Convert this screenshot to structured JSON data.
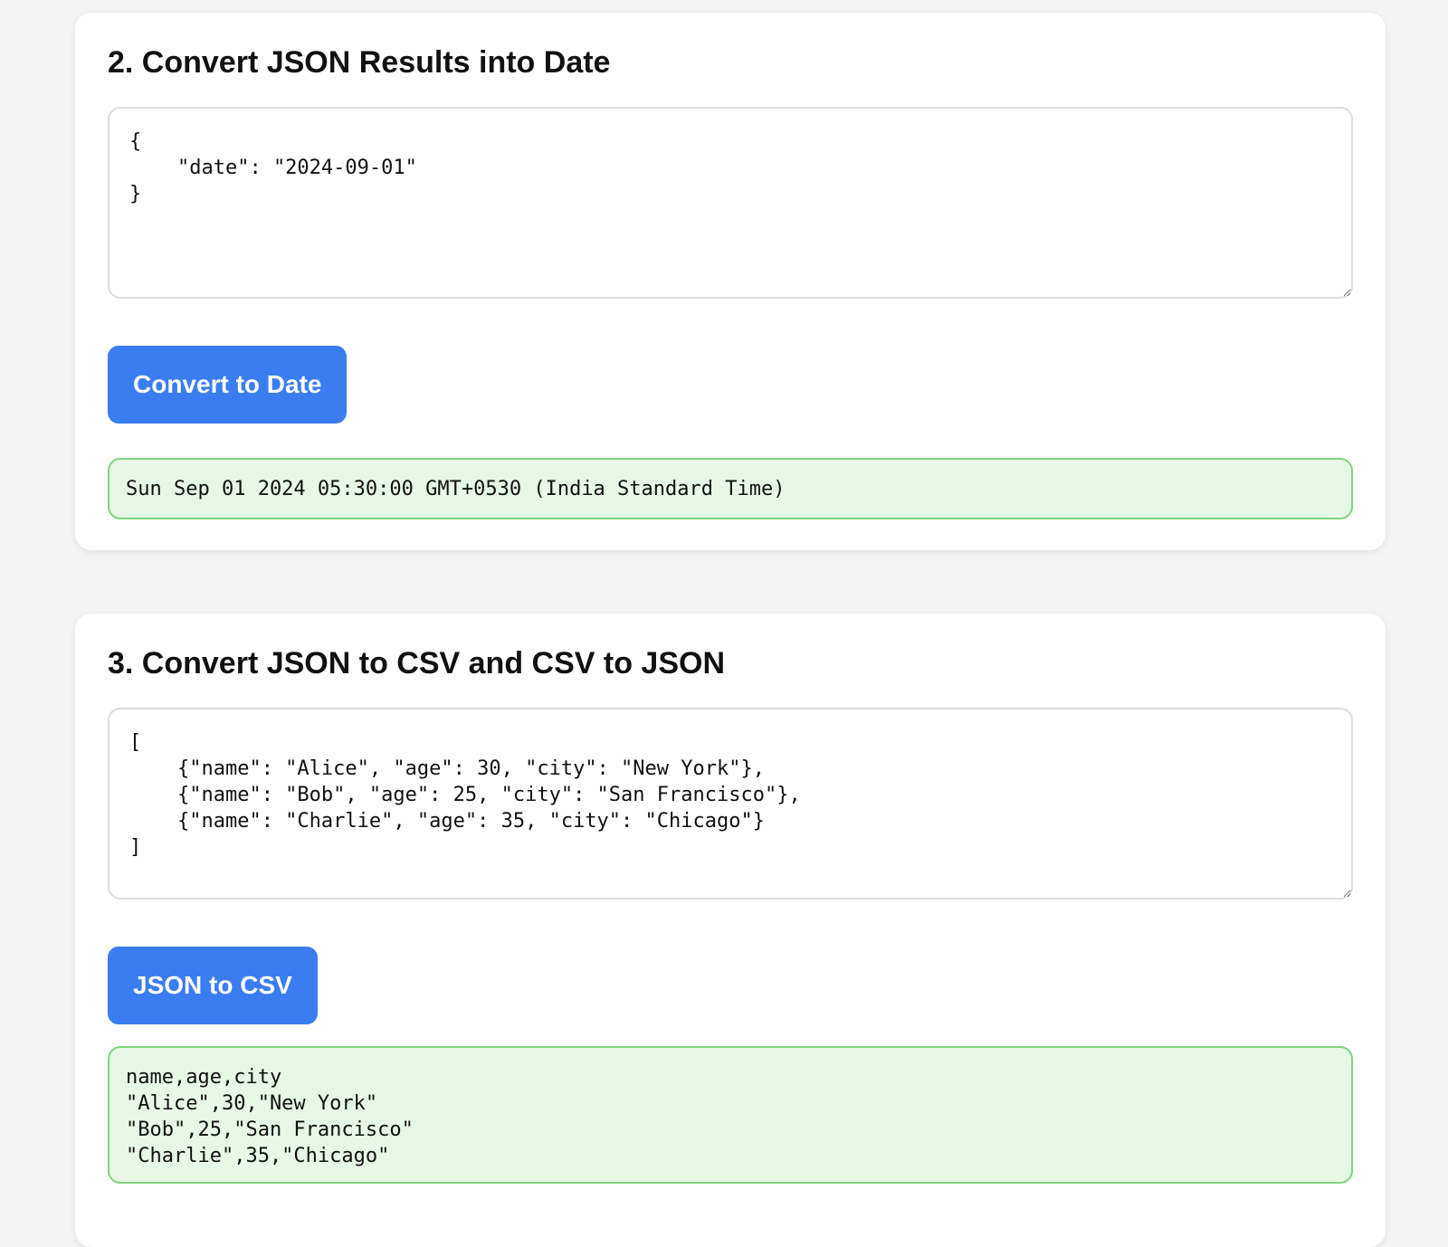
{
  "sections": [
    {
      "title": "2. Convert JSON Results into Date",
      "input_value": "{\n    \"date\": \"2024-09-01\"\n}",
      "button_label": "Convert to Date",
      "output": "Sun Sep 01 2024 05:30:00 GMT+0530 (India Standard Time)"
    },
    {
      "title": "3. Convert JSON to CSV and CSV to JSON",
      "input_value": "[\n    {\"name\": \"Alice\", \"age\": 30, \"city\": \"New York\"},\n    {\"name\": \"Bob\", \"age\": 25, \"city\": \"San Francisco\"},\n    {\"name\": \"Charlie\", \"age\": 35, \"city\": \"Chicago\"}\n]",
      "button_label": "JSON to CSV",
      "output": "name,age,city\n\"Alice\",30,\"New York\"\n\"Bob\",25,\"San Francisco\"\n\"Charlie\",35,\"Chicago\""
    }
  ],
  "colors": {
    "button_bg": "#3b7df0",
    "output_bg": "#e8f8e6",
    "output_border": "#7fd47f"
  }
}
